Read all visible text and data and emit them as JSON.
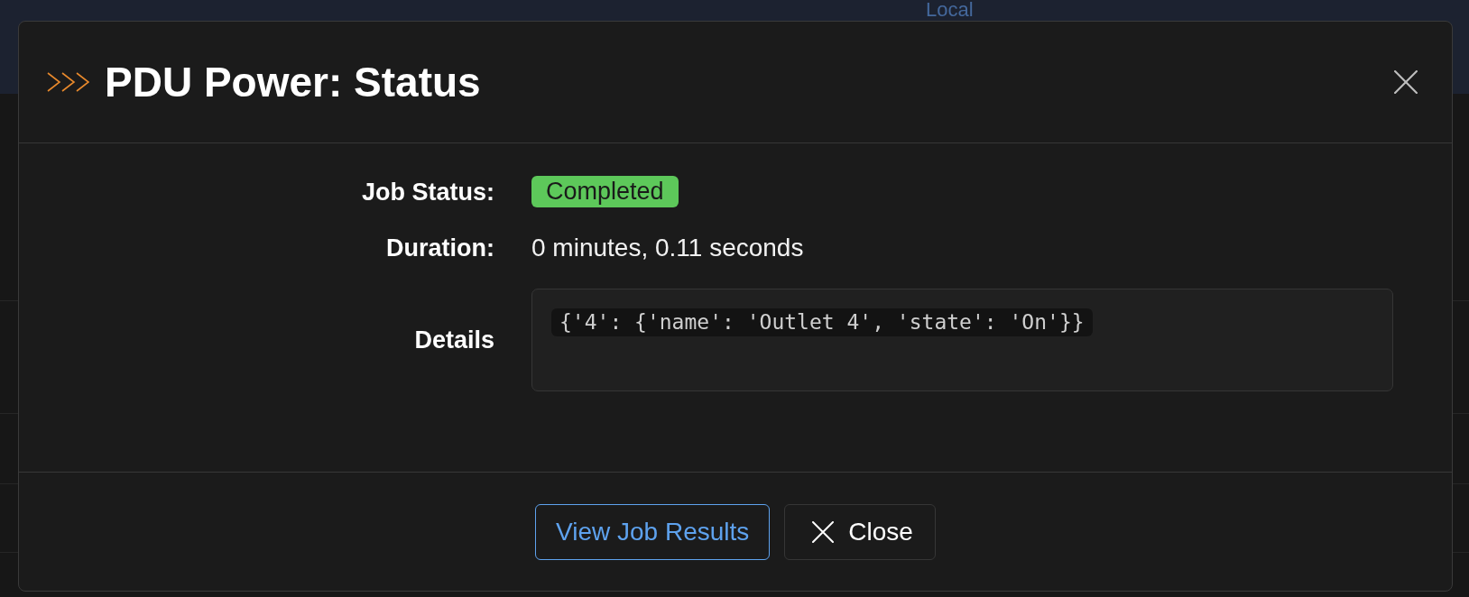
{
  "background": {
    "link": "Local"
  },
  "dialog": {
    "title": "PDU Power: Status",
    "fields": [
      {
        "kind": "badge",
        "label": "Job Status:",
        "value": "Completed"
      },
      {
        "kind": "text",
        "label": "Duration:",
        "value": "0 minutes, 0.11 seconds"
      },
      {
        "kind": "code",
        "label": "Details",
        "value": "{'4': {'name': 'Outlet 4', 'state': 'On'}}"
      }
    ],
    "buttons": [
      {
        "kind": "primary",
        "label": "View Job Results"
      },
      {
        "kind": "close",
        "label": "Close"
      }
    ]
  }
}
